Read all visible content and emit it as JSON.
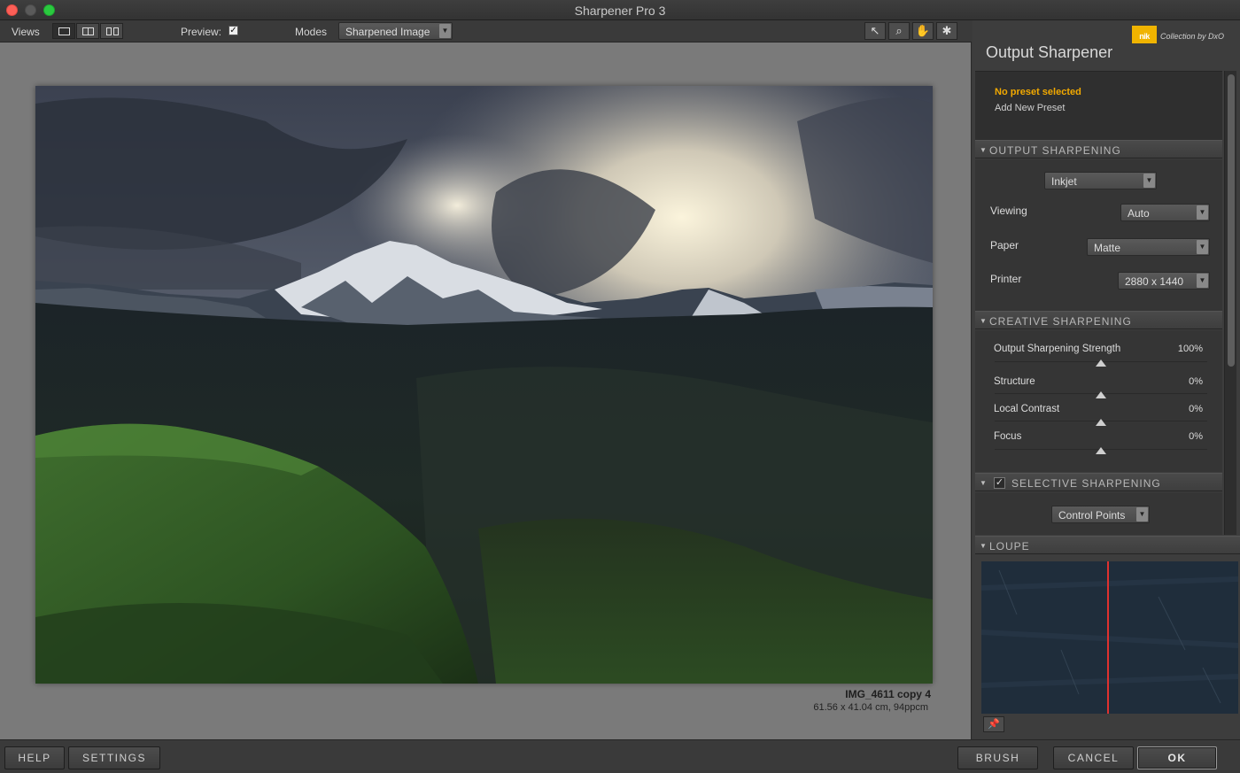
{
  "window": {
    "title": "Sharpener Pro 3"
  },
  "toolbar": {
    "views_label": "Views",
    "preview_label": "Preview:",
    "preview_checked": true,
    "modes_label": "Modes",
    "mode_value": "Sharpened Image",
    "tools": [
      "pointer-icon",
      "zoom-icon",
      "hand-icon",
      "light-icon"
    ]
  },
  "image_info": {
    "file_name": "IMG_4611 copy 4",
    "dimensions": "61.56 x 41.04 cm, 94ppcm"
  },
  "panel": {
    "brand_mark": "nik",
    "brand_text": "Collection by DxO",
    "title": "Output Sharpener",
    "preset_status": "No preset selected",
    "add_preset": "Add New Preset",
    "output_sharpening": {
      "header": "OUTPUT SHARPENING",
      "output_type": "Inkjet",
      "viewing_label": "Viewing",
      "viewing_value": "Auto",
      "paper_label": "Paper",
      "paper_value": "Matte",
      "printer_label": "Printer",
      "printer_value": "2880 x 1440"
    },
    "creative_sharpening": {
      "header": "CREATIVE SHARPENING",
      "sliders": [
        {
          "label": "Output Sharpening Strength",
          "value": "100%",
          "level": 0.5
        },
        {
          "label": "Structure",
          "value": "0%",
          "level": 0.5
        },
        {
          "label": "Local Contrast",
          "value": "0%",
          "level": 0.5
        },
        {
          "label": "Focus",
          "value": "0%",
          "level": 0.5
        }
      ]
    },
    "selective_sharpening": {
      "header": "SELECTIVE SHARPENING",
      "enabled": true,
      "method": "Control Points"
    },
    "loupe": {
      "header": "LOUPE"
    }
  },
  "bottom": {
    "help": "HELP",
    "settings": "SETTINGS",
    "brush": "BRUSH",
    "cancel": "CANCEL",
    "ok": "OK"
  },
  "colors": {
    "accent_preset": "#f2a900",
    "loupe_divider": "#e0312f"
  }
}
